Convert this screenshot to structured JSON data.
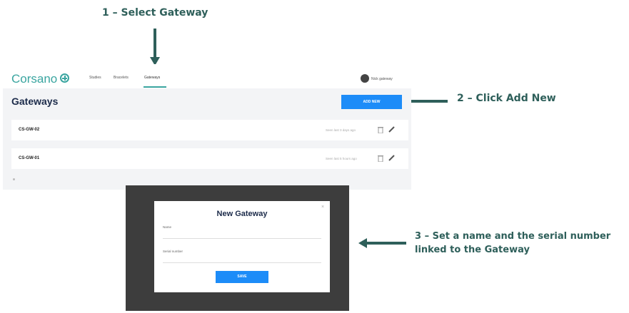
{
  "steps": {
    "step1": "1 – Select Gateway",
    "step2": "2 – Click Add New",
    "step3_line1": "3 – Set a name and the serial number",
    "step3_line2": "linked to the Gateway"
  },
  "app": {
    "logo": "Corsano",
    "nav": [
      "Studies",
      "Bracelets",
      "Gateways"
    ],
    "active_nav": "Gateways",
    "user_name": "Nick gateway",
    "page_title": "Gateways",
    "add_new_label": "ADD NEW",
    "gateways": [
      {
        "name": "CS-GW-02",
        "last_seen": "Seen last 3 days ago"
      },
      {
        "name": "CS-GW-01",
        "last_seen": "Seen last 5 hours ago"
      }
    ]
  },
  "modal": {
    "title": "New Gateway",
    "close_symbol": "×",
    "name_label": "Name",
    "serial_label": "Serial number",
    "name_value": "",
    "serial_value": "",
    "save_label": "SAVE"
  },
  "colors": {
    "annotation": "#2e5f5a",
    "brand": "#3aa5a0",
    "primary_button": "#1d8cf8",
    "title": "#1c2b4a"
  }
}
